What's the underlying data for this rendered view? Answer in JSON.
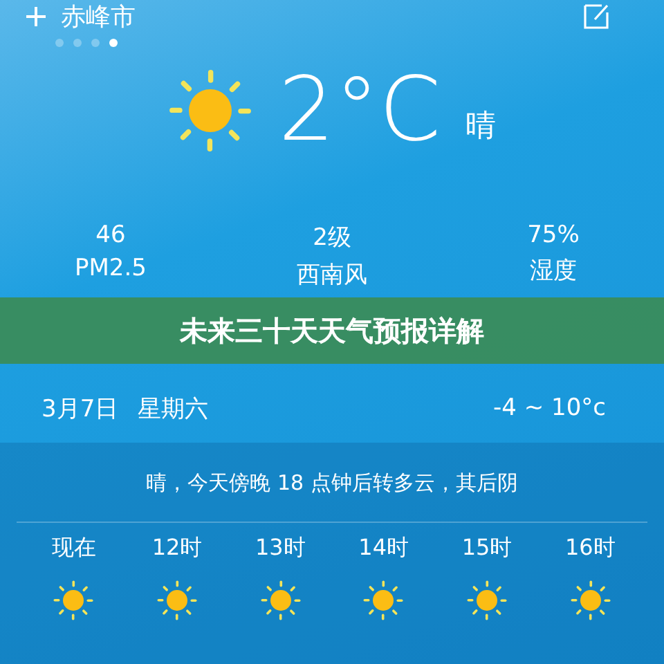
{
  "header": {
    "city": "赤峰市",
    "pages": [
      {
        "selected": false
      },
      {
        "selected": false
      },
      {
        "selected": false
      },
      {
        "selected": true
      }
    ]
  },
  "current": {
    "temperature": "2°C",
    "condition": "晴"
  },
  "stats": [
    {
      "value": "46",
      "label": "PM2.5"
    },
    {
      "value": "2级",
      "label": "西南风"
    },
    {
      "value": "75%",
      "label": "湿度"
    }
  ],
  "banner": {
    "title": "未来三十天天气预报详解"
  },
  "today": {
    "date": "3月7日",
    "weekday": "星期六",
    "range": "-4 ~ 10°c"
  },
  "summary": "晴，今天傍晚 18 点钟后转多云，其后阴",
  "hours": [
    {
      "label": "现在"
    },
    {
      "label": "12时"
    },
    {
      "label": "13时"
    },
    {
      "label": "14时"
    },
    {
      "label": "15时"
    },
    {
      "label": "16时"
    }
  ]
}
